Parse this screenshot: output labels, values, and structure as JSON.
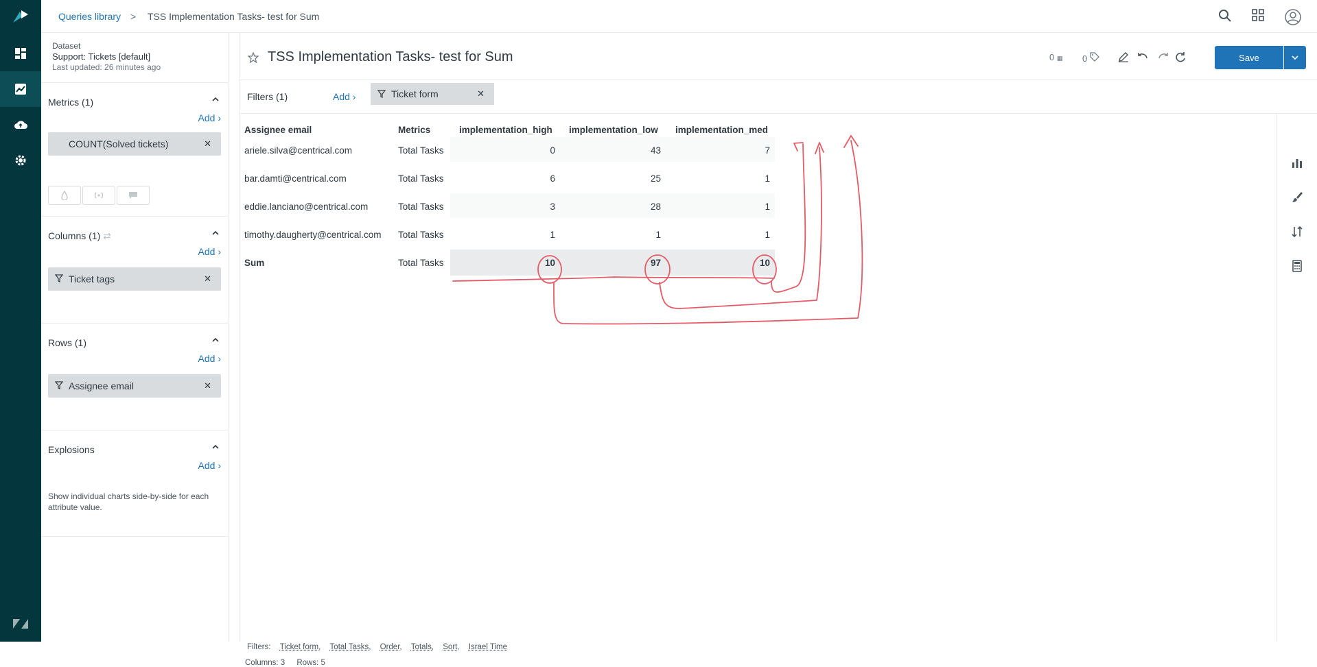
{
  "breadcrumb": {
    "link": "Queries library",
    "sep": ">",
    "current": "TSS Implementation Tasks- test for Sum"
  },
  "dataset": {
    "label": "Dataset",
    "name": "Support: Tickets [default]",
    "updated": "Last updated: 26 minutes ago"
  },
  "metrics": {
    "title": "Metrics (1)",
    "add": "Add",
    "items": [
      "COUNT(Solved tickets)"
    ]
  },
  "columns": {
    "title": "Columns (1)",
    "add": "Add",
    "items": [
      "Ticket tags"
    ]
  },
  "rows": {
    "title": "Rows (1)",
    "add": "Add",
    "items": [
      "Assignee email"
    ]
  },
  "explosions": {
    "title": "Explosions",
    "add": "Add",
    "description": "Show individual charts side-by-side for each attribute value."
  },
  "query": {
    "title": "TSS Implementation Tasks- test for Sum",
    "counter_a": "0",
    "counter_b": "0",
    "save": "Save"
  },
  "filters": {
    "label": "Filters (1)",
    "add": "Add",
    "chip": "Ticket form"
  },
  "table": {
    "headers": [
      "Assignee email",
      "Metrics",
      "implementation_high",
      "implementation_low",
      "implementation_med"
    ],
    "rows": [
      {
        "email": "ariele.silva@centrical.com",
        "metric": "Total Tasks",
        "high": "0",
        "low": "43",
        "med": "7"
      },
      {
        "email": "bar.damti@centrical.com",
        "metric": "Total Tasks",
        "high": "6",
        "low": "25",
        "med": "1"
      },
      {
        "email": "eddie.lanciano@centrical.com",
        "metric": "Total Tasks",
        "high": "3",
        "low": "28",
        "med": "1"
      },
      {
        "email": "timothy.daugherty@centrical.com",
        "metric": "Total Tasks",
        "high": "1",
        "low": "1",
        "med": "1"
      }
    ],
    "sum": {
      "label": "Sum",
      "metric": "Total Tasks",
      "high": "10",
      "low": "97",
      "med": "10"
    }
  },
  "footer": {
    "filters_label": "Filters:",
    "filters": [
      "Ticket form,",
      "Total Tasks,",
      "Order,",
      "Totals,",
      "Sort,",
      "Israel Time"
    ],
    "columns": "Columns: 3",
    "rows": "Rows: 5"
  },
  "colors": {
    "nav": "#03363d",
    "accent": "#1f73b7",
    "annotation": "#e35b66"
  }
}
